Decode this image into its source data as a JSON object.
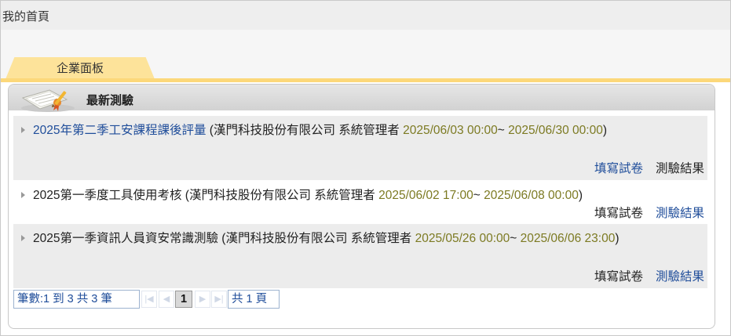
{
  "page": {
    "title": "我的首頁"
  },
  "tabs": [
    {
      "label": "企業面板"
    }
  ],
  "panel": {
    "title": "最新測驗"
  },
  "exams": [
    {
      "name": "2025年第二季工安課程課後評量",
      "org": "(漢門科技股份有限公司 系統管理者",
      "start": "2025/06/03 00:00",
      "sep": "~",
      "end": "2025/06/30 00:00",
      "close": ")",
      "fill_label": "填寫試卷",
      "result_label": "測驗結果"
    },
    {
      "name": "2025第一季度工具使用考核",
      "org": "(漢門科技股份有限公司 系統管理者",
      "start": "2025/06/02 17:00",
      "sep": "~",
      "end": "2025/06/08 00:00",
      "close": ")",
      "fill_label": "填寫試卷",
      "result_label": "測驗結果"
    },
    {
      "name": "2025第一季資訊人員資安常識測驗",
      "org": "(漢門科技股份有限公司 系統管理者",
      "start": "2025/05/26 00:00",
      "sep": "~",
      "end": "2025/06/06 23:00",
      "close": ")",
      "fill_label": "填寫試卷",
      "result_label": "測驗結果"
    }
  ],
  "pager": {
    "summary": "筆數:1 到 3 共 3 筆",
    "current_page": "1",
    "total": "共 1 頁",
    "first_icon": "first-page-icon",
    "prev_icon": "prev-page-icon",
    "next_icon": "next-page-icon",
    "last_icon": "last-page-icon"
  },
  "colors": {
    "tab": "#fde39a",
    "link": "#1f4d9a",
    "date": "#7c7a22",
    "row_shade": "#ececec"
  }
}
